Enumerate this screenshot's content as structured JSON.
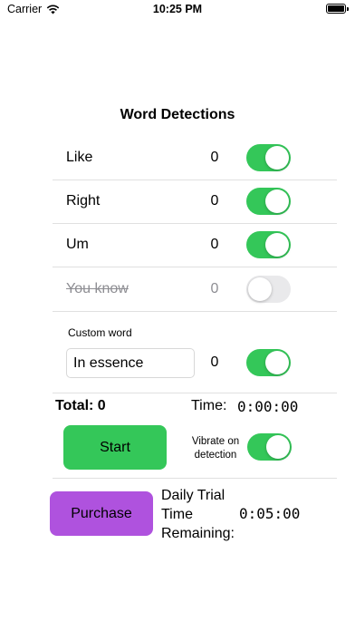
{
  "status_bar": {
    "carrier": "Carrier",
    "time": "10:25 PM"
  },
  "title": "Word Detections",
  "words": [
    {
      "label": "Like",
      "count": "0",
      "enabled": true
    },
    {
      "label": "Right",
      "count": "0",
      "enabled": true
    },
    {
      "label": "Um",
      "count": "0",
      "enabled": true
    },
    {
      "label": "You know",
      "count": "0",
      "enabled": false
    }
  ],
  "custom": {
    "label": "Custom word",
    "value": "In essence",
    "count": "0",
    "enabled": true
  },
  "summary": {
    "total_label": "Total: 0",
    "time_label": "Time:",
    "time_value": "0:00:00"
  },
  "start_button": "Start",
  "vibrate": {
    "label": "Vibrate on detection",
    "enabled": true
  },
  "purchase_button": "Purchase",
  "trial": {
    "label": "Daily Trial Time Remaining:",
    "value": "0:05:00"
  },
  "colors": {
    "toggle_on": "#34c759",
    "toggle_off": "#e9e9eb",
    "start": "#34c759",
    "purchase": "#af52de"
  }
}
